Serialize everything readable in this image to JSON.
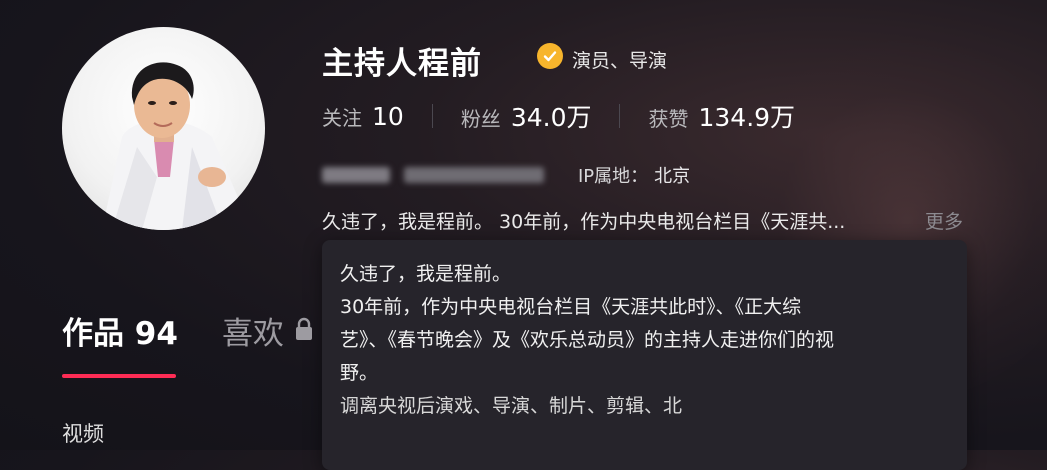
{
  "profile": {
    "name": "主持人程前",
    "verified_label": "演员、导演",
    "stats": [
      {
        "label": "关注",
        "value": "10"
      },
      {
        "label": "粉丝",
        "value": "34.0万"
      },
      {
        "label": "获赞",
        "value": "134.9万"
      }
    ],
    "ip_label": "IP属地：",
    "ip_value": "北京",
    "bio_short": "久违了，我是程前。 30年前，作为中央电视台栏目《天涯共...",
    "more_label": "更多"
  },
  "bio_popup": {
    "lines": [
      "久违了，我是程前。",
      "30年前，作为中央电视台栏目《天涯共此时》、《正大综",
      "艺》、《春节晚会》及《欢乐总动员》的主持人走进你们的视",
      "野。",
      "调离央视后演戏、导演、制片、剪辑、北"
    ]
  },
  "tabs": {
    "works_label": "作品",
    "works_count": "94",
    "likes_label": "喜欢"
  },
  "subtabs": {
    "video_label": "视频"
  },
  "colors": {
    "accent": "#fe2c55",
    "verified": "#f7b52c",
    "background": "#17151c"
  },
  "icons": {
    "verified": "verified-check-icon",
    "lock": "lock-icon"
  }
}
